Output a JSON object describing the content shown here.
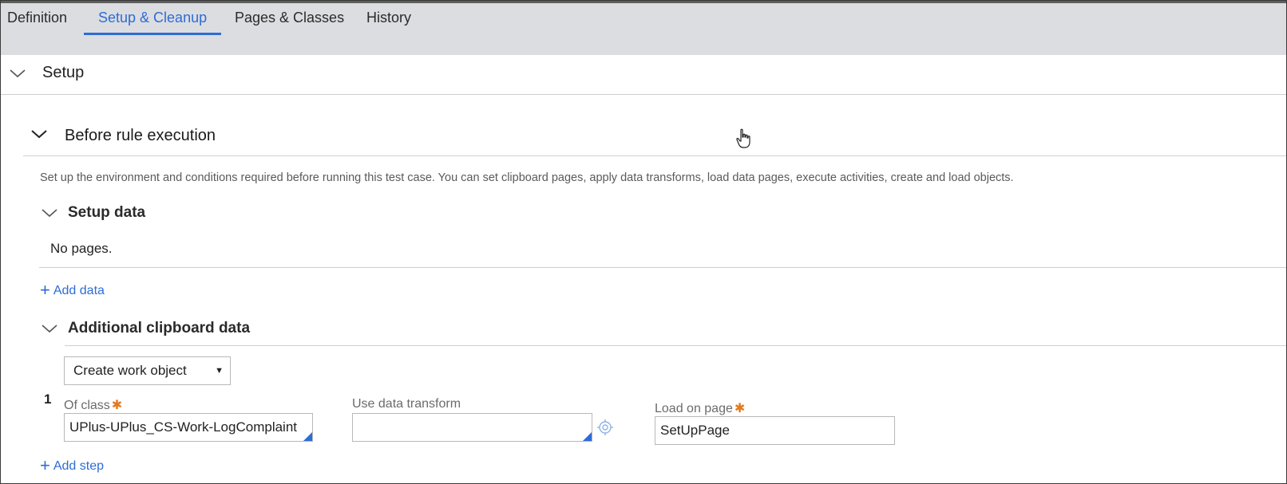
{
  "tabs": [
    {
      "label": "Definition",
      "active": false
    },
    {
      "label": "Setup & Cleanup",
      "active": true
    },
    {
      "label": "Pages & Classes",
      "active": false
    },
    {
      "label": "History",
      "active": false
    }
  ],
  "setup": {
    "title": "Setup",
    "before": {
      "title": "Before rule execution",
      "description": "Set up the environment and conditions required before running this test case. You can set clipboard pages, apply data transforms, load data pages, execute activities, create and load objects."
    },
    "setup_data": {
      "title": "Setup data",
      "empty_text": "No pages.",
      "add_label": "Add data"
    },
    "clipboard": {
      "title": "Additional clipboard data",
      "action_select": "Create work object",
      "step_number": "1",
      "of_class_label": "Of class",
      "of_class_value": "UPlus-UPlus_CS-Work-LogComplaint",
      "transform_label": "Use data transform",
      "transform_value": "",
      "load_page_label": "Load on page",
      "load_page_value": "SetUpPage",
      "add_step_label": "Add step"
    }
  },
  "colors": {
    "accent": "#2e6cd6",
    "required": "#e07b22",
    "tabbar_bg": "#dcdde1"
  },
  "icons": {
    "chevron": "chevron-down-icon",
    "plus": "plus-icon",
    "target": "target-icon",
    "cursor": "hand-cursor-icon"
  }
}
